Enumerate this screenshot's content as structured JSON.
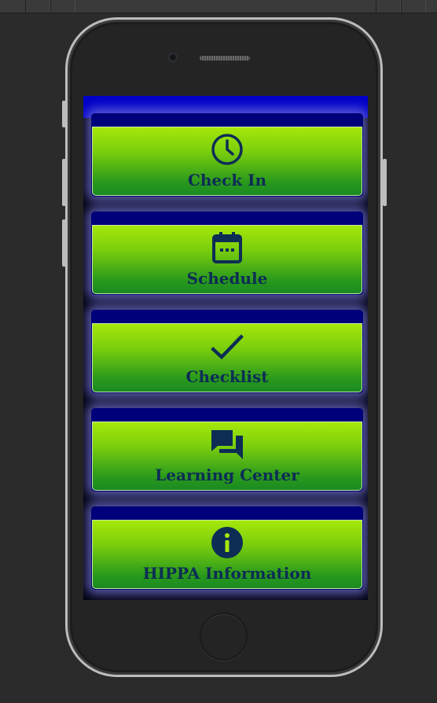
{
  "menu": {
    "items": [
      {
        "label": "Check In",
        "icon": "clock-icon"
      },
      {
        "label": "Schedule",
        "icon": "calendar-icon"
      },
      {
        "label": "Checklist",
        "icon": "checkmark-icon"
      },
      {
        "label": "Learning Center",
        "icon": "chat-bubbles-icon"
      },
      {
        "label": "HIPPA Information",
        "icon": "info-icon"
      }
    ]
  },
  "colors": {
    "screen_header": "#0000c8",
    "card_band": "#00007a",
    "card_gradient_top": "#a6e70a",
    "card_gradient_bottom": "#1a8a22",
    "label_color": "#0d2d55"
  }
}
